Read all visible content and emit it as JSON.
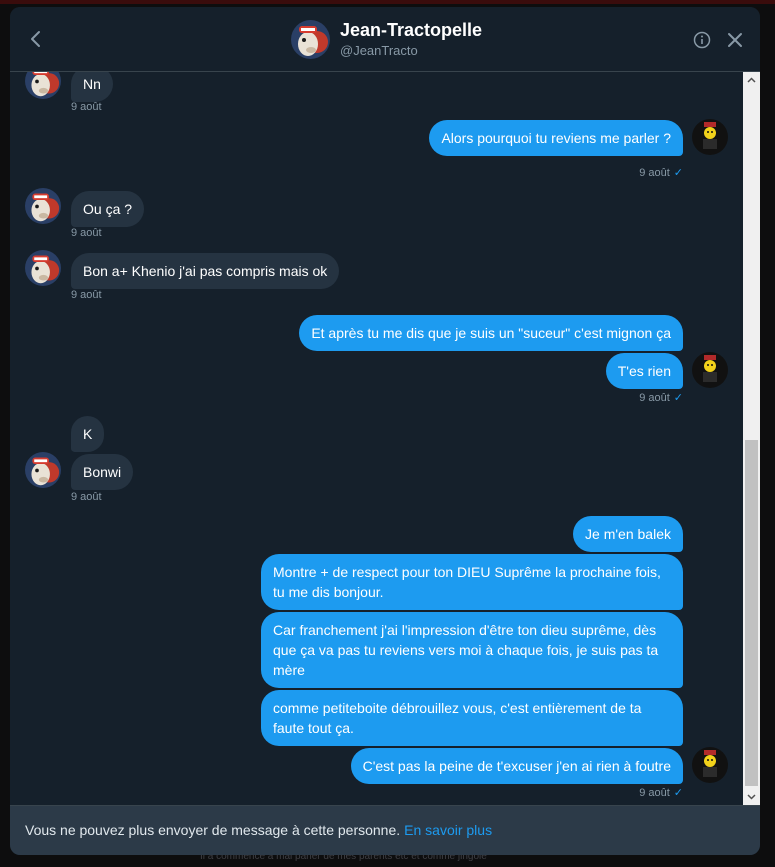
{
  "background_text": "Il a commencé à mal parler de mes parents etc et comme jingole",
  "header": {
    "name": "Jean-Tractopelle",
    "handle": "@JeanTracto"
  },
  "icons": {
    "back": "chevron-left-icon",
    "info": "info-icon",
    "close": "close-icon",
    "check": "check-icon"
  },
  "colors": {
    "modal_bg": "#15202b",
    "incoming_bubble": "#253341",
    "outgoing_bubble": "#1d9bf0",
    "footer_bg": "#2c3a48",
    "link": "#1d9bf0"
  },
  "messages": [
    {
      "dir": "in",
      "text": "Nn"
    },
    {
      "dir": "in",
      "time": "9 août"
    },
    {
      "dir": "out",
      "text": "Alors pourquoi tu reviens me parler ?"
    },
    {
      "dir": "out",
      "time": "9 août"
    },
    {
      "dir": "in",
      "text": "Ou ça ?"
    },
    {
      "dir": "in",
      "time": "9 août"
    },
    {
      "dir": "in",
      "text": "Bon a+ Khenio j'ai pas compris mais ok"
    },
    {
      "dir": "in",
      "time": "9 août"
    },
    {
      "dir": "out",
      "text": "Et après tu me dis que je suis un \"suceur\" c'est mignon ça"
    },
    {
      "dir": "out",
      "text": "T'es rien"
    },
    {
      "dir": "out",
      "time": "9 août"
    },
    {
      "dir": "in",
      "text": "K"
    },
    {
      "dir": "in",
      "text": "Bonwi"
    },
    {
      "dir": "in",
      "time": "9 août"
    },
    {
      "dir": "out",
      "text": "Je m'en balek"
    },
    {
      "dir": "out",
      "text": "Montre + de respect pour ton DIEU Suprême la prochaine fois, tu me dis bonjour."
    },
    {
      "dir": "out",
      "text": "Car franchement j'ai l'impression d'être ton dieu suprême, dès que ça va pas tu reviens vers moi à chaque fois, je suis pas ta mère"
    },
    {
      "dir": "out",
      "text": "comme petiteboite débrouillez vous, c'est entièrement de ta faute tout ça."
    },
    {
      "dir": "out",
      "text": "C'est pas la peine de t'excuser j'en ai rien à foutre"
    },
    {
      "dir": "out",
      "time": "9 août"
    }
  ],
  "check_mark": "✓",
  "footer": {
    "notice": "Vous ne pouvez plus envoyer de message à cette personne.",
    "link": "En savoir plus"
  }
}
